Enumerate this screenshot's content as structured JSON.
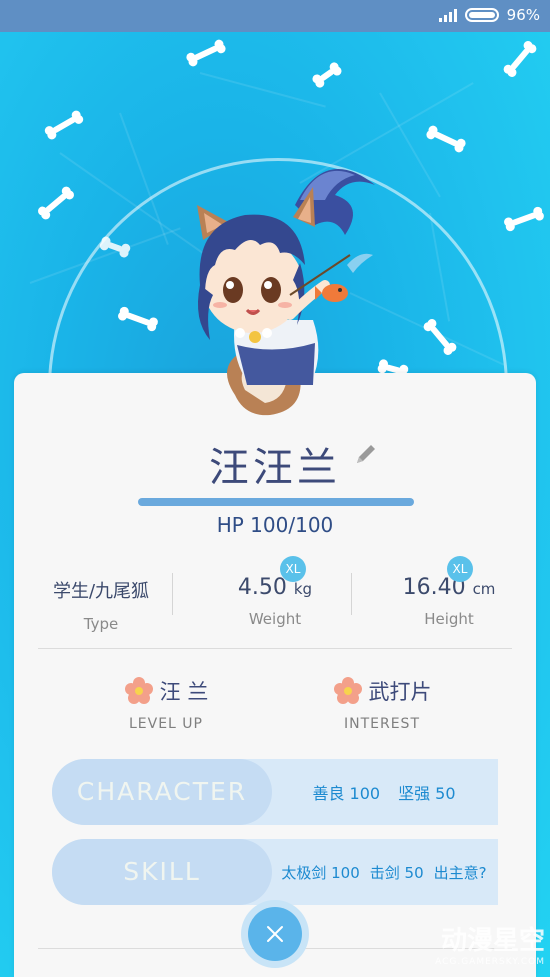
{
  "status_bar": {
    "battery_percent": "96%"
  },
  "character": {
    "name": "汪汪兰",
    "hp_label": "HP 100/100",
    "hp_fraction": 1.0
  },
  "stats": {
    "type_value": "学生/九尾狐",
    "type_label": "Type",
    "weight_value": "4.50",
    "weight_unit": "kg",
    "weight_label": "Weight",
    "weight_badge": "XL",
    "height_value": "16.40",
    "height_unit": "cm",
    "height_label": "Height",
    "height_badge": "XL"
  },
  "info": {
    "level_up_value": "汪 兰",
    "level_up_label": "LEVEL UP",
    "interest_value": "武打片",
    "interest_label": "INTEREST"
  },
  "character_row": {
    "tab_label": "CHARACTER",
    "values": [
      "善良 100",
      "坚强 50"
    ]
  },
  "skill_row": {
    "tab_label": "SKILL",
    "values": [
      "太极剑 100",
      "击剑 50",
      "出主意?"
    ]
  },
  "watermark": {
    "text": "动漫星空",
    "sub": "ACG.GAMERSKY.COM"
  },
  "colors": {
    "accent": "#5ab4ea",
    "title": "#3d4a7a",
    "hp_bar": "#6aa9dd",
    "skill_text": "#1d8ad0"
  }
}
